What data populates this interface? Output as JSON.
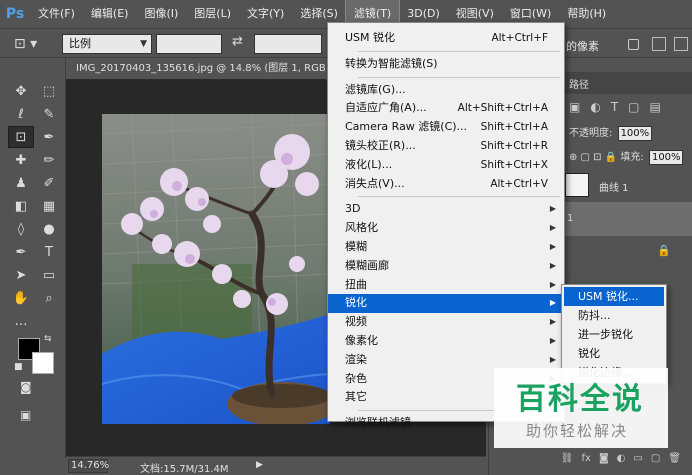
{
  "app": {
    "logo": "Ps"
  },
  "menubar": {
    "items": [
      "文件(F)",
      "编辑(E)",
      "图像(I)",
      "图层(L)",
      "文字(Y)",
      "选择(S)",
      "滤镜(T)",
      "3D(D)",
      "视图(V)",
      "窗口(W)",
      "帮助(H)"
    ],
    "active_index": 6
  },
  "options": {
    "tool_icon": "crop-icon",
    "ratio_select": "比例",
    "right_text": "的像素"
  },
  "document": {
    "tab_title": "IMG_20170403_135616.jpg @ 14.8% (图层 1, RGB/8)",
    "zoom": "14.76%",
    "doc_info": "文档:15.7M/31.4M"
  },
  "filter_menu": {
    "group1": [
      {
        "label": "USM 锐化",
        "shortcut": "Alt+Ctrl+F"
      }
    ],
    "group2": [
      {
        "label": "转换为智能滤镜(S)",
        "shortcut": ""
      }
    ],
    "group3": [
      {
        "label": "滤镜库(G)...",
        "shortcut": ""
      },
      {
        "label": "自适应广角(A)...",
        "shortcut": "Alt+Shift+Ctrl+A"
      },
      {
        "label": "Camera Raw 滤镜(C)...",
        "shortcut": "Shift+Ctrl+A"
      },
      {
        "label": "镜头校正(R)...",
        "shortcut": "Shift+Ctrl+R"
      },
      {
        "label": "液化(L)...",
        "shortcut": "Shift+Ctrl+X"
      },
      {
        "label": "消失点(V)...",
        "shortcut": "Alt+Ctrl+V"
      }
    ],
    "group4": [
      {
        "label": "3D"
      },
      {
        "label": "风格化"
      },
      {
        "label": "模糊"
      },
      {
        "label": "模糊画廊"
      },
      {
        "label": "扭曲"
      },
      {
        "label": "锐化"
      },
      {
        "label": "视频"
      },
      {
        "label": "像素化"
      },
      {
        "label": "渲染"
      },
      {
        "label": "杂色"
      },
      {
        "label": "其它"
      }
    ],
    "highlighted": "锐化",
    "group5": [
      {
        "label": "浏览联机滤镜..."
      }
    ]
  },
  "sharpen_submenu": {
    "items": [
      "USM 锐化...",
      "防抖...",
      "进一步锐化",
      "锐化",
      "锐化边缘..."
    ],
    "highlighted_index": 0
  },
  "layers_panel": {
    "tab_label": "路径",
    "opacity_label": "不透明度:",
    "opacity_value": "100%",
    "fill_label": "填充:",
    "fill_value": "100%",
    "layer1_name": "曲线 1",
    "layer2_name": "1"
  },
  "watermark": {
    "title": "百科全说",
    "subtitle": "助你轻松解决"
  }
}
